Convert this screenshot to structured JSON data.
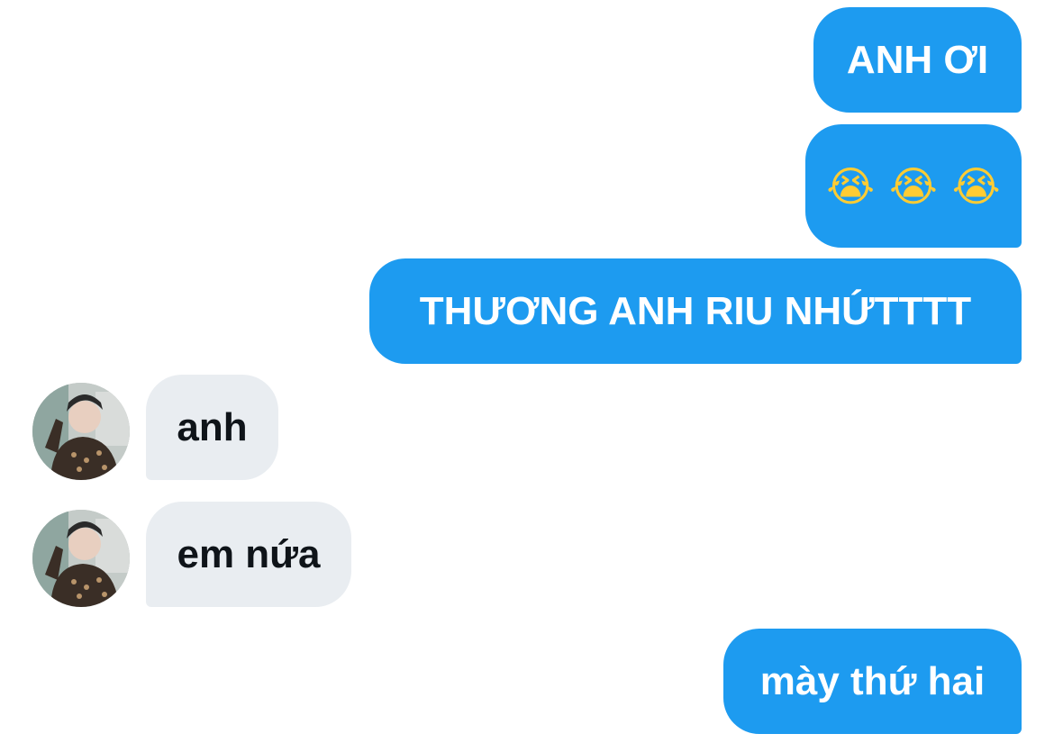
{
  "messages": [
    {
      "direction": "sent",
      "text": "ANH ƠI"
    },
    {
      "direction": "sent",
      "emojis": [
        "😭",
        "😭",
        "😭"
      ]
    },
    {
      "direction": "sent",
      "text": "THƯƠNG ANH RIU NHỨTTTT"
    },
    {
      "direction": "received",
      "text": "anh"
    },
    {
      "direction": "received",
      "text": "em nứa"
    },
    {
      "direction": "sent",
      "text": "mày thứ hai"
    }
  ],
  "colors": {
    "sent_bubble": "#1d9bf0",
    "received_bubble": "#e9edf1",
    "sent_text": "#ffffff",
    "received_text": "#0f1419"
  }
}
